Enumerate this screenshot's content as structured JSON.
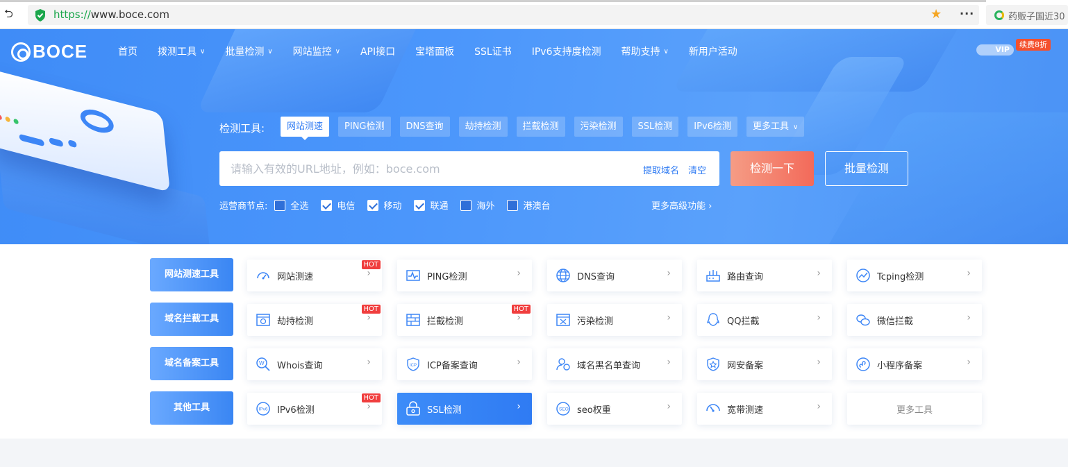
{
  "browser": {
    "url_protocol": "https://",
    "url_rest": "www.boce.com",
    "side_tab": "药贩子国近30"
  },
  "header": {
    "logo_text": "BOCE",
    "nav": [
      {
        "label": "首页",
        "dropdown": false
      },
      {
        "label": "拨测工具",
        "dropdown": true
      },
      {
        "label": "批量检测",
        "dropdown": true
      },
      {
        "label": "网站监控",
        "dropdown": true
      },
      {
        "label": "API接口",
        "dropdown": false
      },
      {
        "label": "宝塔面板",
        "dropdown": false
      },
      {
        "label": "SSL证书",
        "dropdown": false
      },
      {
        "label": "IPv6支持度检测",
        "dropdown": false
      },
      {
        "label": "帮助支持",
        "dropdown": true
      },
      {
        "label": "新用户活动",
        "dropdown": false
      }
    ],
    "vip_label": "VIP",
    "vip_badge": "续费8折"
  },
  "search": {
    "tools_label": "检测工具:",
    "tabs": [
      "网站测速",
      "PING检测",
      "DNS查询",
      "劫持检测",
      "拦截检测",
      "污染检测",
      "SSL检测",
      "IPv6检测",
      "更多工具"
    ],
    "active_tab": "网站测速",
    "placeholder": "请输入有效的URL地址，例如：boce.com",
    "extract_label": "提取域名",
    "clear_label": "清空",
    "check_button": "检测一下",
    "batch_button": "批量检测",
    "isp_label": "运营商节点:",
    "isp_options": [
      {
        "label": "全选",
        "checked": false
      },
      {
        "label": "电信",
        "checked": true
      },
      {
        "label": "移动",
        "checked": true
      },
      {
        "label": "联通",
        "checked": true
      },
      {
        "label": "海外",
        "checked": false
      },
      {
        "label": "港澳台",
        "checked": false
      }
    ],
    "more_advanced": "更多高级功能"
  },
  "categories": [
    {
      "label": "网站测速工具",
      "tools": [
        {
          "label": "网站测速",
          "icon": "speedometer-icon",
          "hot": "HOT"
        },
        {
          "label": "PING检测",
          "icon": "pulse-chart-icon",
          "hot": ""
        },
        {
          "label": "DNS查询",
          "icon": "globe-icon",
          "hot": ""
        },
        {
          "label": "路由查询",
          "icon": "router-icon",
          "hot": ""
        },
        {
          "label": "Tcping检测",
          "icon": "trend-line-icon",
          "hot": ""
        }
      ]
    },
    {
      "label": "域名拦截工具",
      "tools": [
        {
          "label": "劫持检测",
          "icon": "hijack-icon",
          "hot": "HOT"
        },
        {
          "label": "拦截检测",
          "icon": "firewall-icon",
          "hot": "HOT"
        },
        {
          "label": "污染检测",
          "icon": "pollution-icon",
          "hot": ""
        },
        {
          "label": "QQ拦截",
          "icon": "qq-icon",
          "hot": ""
        },
        {
          "label": "微信拦截",
          "icon": "wechat-icon",
          "hot": ""
        }
      ]
    },
    {
      "label": "域名备案工具",
      "tools": [
        {
          "label": "Whois查询",
          "icon": "whois-search-icon",
          "hot": ""
        },
        {
          "label": "ICP备案查询",
          "icon": "icp-shield-icon",
          "hot": ""
        },
        {
          "label": "域名黑名单查询",
          "icon": "blacklist-user-icon",
          "hot": ""
        },
        {
          "label": "网安备案",
          "icon": "security-badge-icon",
          "hot": ""
        },
        {
          "label": "小程序备案",
          "icon": "mini-program-icon",
          "hot": ""
        }
      ]
    },
    {
      "label": "其他工具",
      "tools": [
        {
          "label": "IPv6检测",
          "icon": "ipv6-icon",
          "hot": "HOT"
        },
        {
          "label": "SSL检测",
          "icon": "ssl-lock-icon",
          "hot": "",
          "selected": true
        },
        {
          "label": "seo权重",
          "icon": "seo-icon",
          "hot": ""
        },
        {
          "label": "宽带测速",
          "icon": "gauge-icon",
          "hot": ""
        },
        {
          "label": "更多工具",
          "icon": "",
          "hot": "",
          "more": true
        }
      ]
    }
  ],
  "colors": {
    "hero_blue": "#4b96fb",
    "accent_blue": "#2f7bf3",
    "check_button": "#f36a5a",
    "hot_badge": "#f03e3e",
    "vip_badge": "#f4502d"
  }
}
